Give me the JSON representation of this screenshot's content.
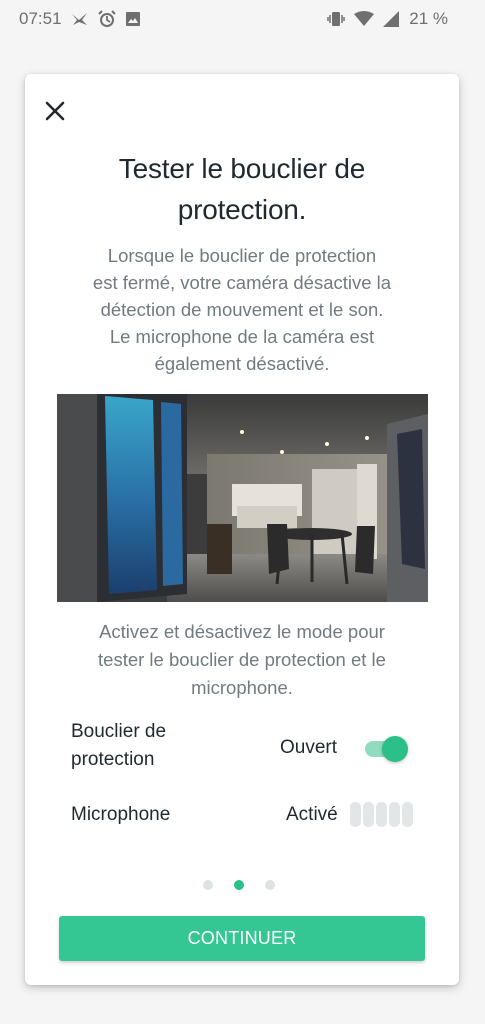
{
  "status_bar": {
    "time": "07:51",
    "battery_percent": "21 %",
    "left_icons": [
      "notification-bird-icon",
      "alarm-icon",
      "image-icon"
    ],
    "right_icons": [
      "vibrate-icon",
      "wifi-icon",
      "signal-icon"
    ]
  },
  "dialog": {
    "title": "Tester le bouclier de protection.",
    "description_lines": [
      "Lorsque le bouclier de protection",
      "est fermé, votre caméra désactive la",
      "détection de mouvement et le son.",
      "Le microphone de la caméra est",
      "également désactivé."
    ],
    "instruction_lines": [
      "Activez et désactivez le mode pour",
      "tester le bouclier de protection et le",
      "microphone."
    ],
    "shield_row": {
      "label_line1": "Bouclier de",
      "label_line2": "protection",
      "value": "Ouvert",
      "toggle_on": true
    },
    "mic_row": {
      "label": "Microphone",
      "value": "Activé",
      "level_bars_total": 5,
      "level_bars_active": 0
    },
    "pagination": {
      "total": 3,
      "active_index": 1
    },
    "continue_label": "CONTINUER"
  },
  "colors": {
    "accent": "#34c793",
    "toggle_knob": "#2bbf8a",
    "toggle_track": "#8fdcbf",
    "title_text": "#1f2a30",
    "body_text": "#707b80",
    "background": "#f5f5f5"
  }
}
